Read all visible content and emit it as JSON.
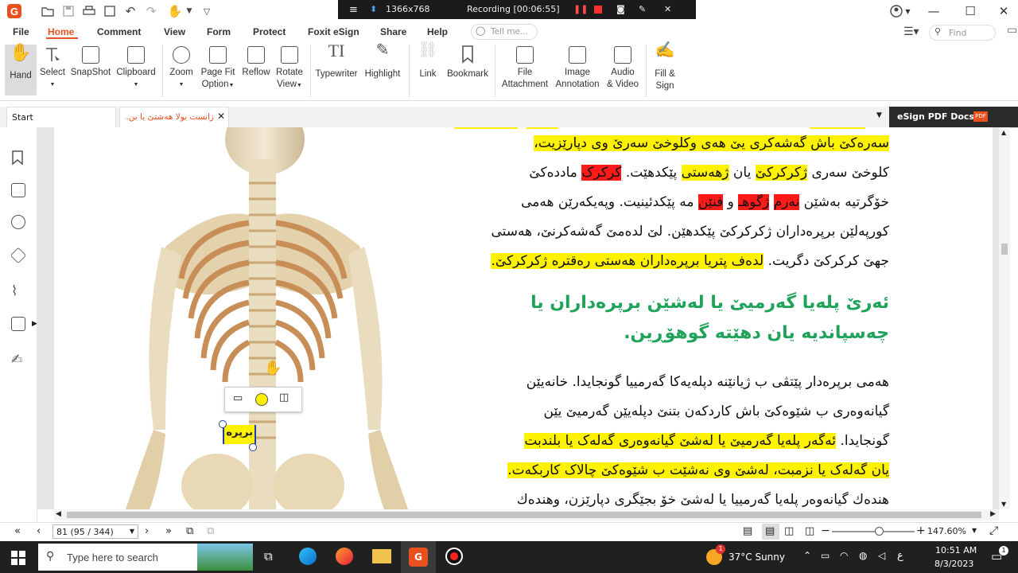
{
  "titlebar": {
    "resolution": "1366x768",
    "recording": "Recording [00:06:55]"
  },
  "menu": [
    "File",
    "Home",
    "Comment",
    "View",
    "Form",
    "Protect",
    "Foxit eSign",
    "Share",
    "Help"
  ],
  "menu_active": "Home",
  "tell_me_placeholder": "Tell me...",
  "find_placeholder": "Find",
  "ribbon": {
    "hand": "Hand",
    "select": "Select",
    "snapshot": "SnapShot",
    "clipboard": "Clipboard",
    "zoom": "Zoom",
    "page_fit_1": "Page Fit",
    "page_fit_2": "Option",
    "reflow": "Reflow",
    "rotate_1": "Rotate",
    "rotate_2": "View",
    "typewriter": "Typewriter",
    "highlight": "Highlight",
    "link": "Link",
    "bookmark": "Bookmark",
    "file_att_1": "File",
    "file_att_2": "Attachment",
    "image_ann_1": "Image",
    "image_ann_2": "Annotation",
    "audio_1": "Audio",
    "audio_2": "& Video",
    "fill_1": "Fill &",
    "fill_2": "Sign"
  },
  "tabs": {
    "start": "Start",
    "doc_tab": "زانست یولا هەشتێ یا بن...",
    "esign": "eSign PDF Docs"
  },
  "document": {
    "lines": [
      {
        "segments": [
          {
            "t": "سەرەکێ باش گەشەکری یێ هەی وکلوخێ سەرێ وی دپارێزیت،",
            "h": "y"
          }
        ]
      },
      {
        "segments": [
          {
            "t": "کلوخێ سەری ",
            "h": ""
          },
          {
            "t": "ژکرکرکێ",
            "h": "y"
          },
          {
            "t": " یان ",
            "h": ""
          },
          {
            "t": "ژهەستی",
            "h": "y"
          },
          {
            "t": " پێکدهێت. ",
            "h": ""
          },
          {
            "t": "کرکرک",
            "h": "r"
          },
          {
            "t": " ماددەکێ",
            "h": ""
          }
        ]
      },
      {
        "segments": [
          {
            "t": "خۆگرتیە بەشێن ",
            "h": ""
          },
          {
            "t": "نەرم",
            "h": "r"
          },
          {
            "t": " ",
            "h": ""
          },
          {
            "t": "ژگوهـ",
            "h": "r"
          },
          {
            "t": " و ",
            "h": ""
          },
          {
            "t": "فنێن",
            "h": "r"
          },
          {
            "t": " مە پێکدئینیت. وپەیکەرێن هەمی",
            "h": ""
          }
        ]
      },
      {
        "segments": [
          {
            "t": "کورپەلێن برپرەداران ژکرکرکێ پێکدهێن. لێ لدەمێ گەشەکرنێ، هەستی",
            "h": ""
          }
        ]
      },
      {
        "segments": [
          {
            "t": "جهێ کرکرکێ دگریت. ",
            "h": ""
          },
          {
            "t": "لدەف پتریا برپرەداران هەستی رەقترە ژکرکرکێ.",
            "h": "y"
          }
        ]
      }
    ],
    "heading_1": "ئەرێ پلەیا گەرمیێ یا لەشێن برپرەداران یا",
    "heading_2": "چەسپاندیە یان دهێتە گوهۆڕین.",
    "lines2": [
      {
        "segments": [
          {
            "t": "هەمی برپرەدار پێتڤی ب ژیانێنە دپلەیەکا گەرمییا گونجایدا. خانەیێن",
            "h": ""
          }
        ]
      },
      {
        "segments": [
          {
            "t": "گیانەوەری ب شێوەکێ باش کاردکەن بتنێ دپلەیێن گەرمیێ یێن",
            "h": ""
          }
        ]
      },
      {
        "segments": [
          {
            "t": "گونجایدا. ",
            "h": ""
          },
          {
            "t": "ئەگەر پلەیا گەرمیێ یا لەشێ گیانەوەری گەلەک یا بلندبت",
            "h": "y"
          }
        ]
      },
      {
        "segments": [
          {
            "t": "یان گەلەک یا نزمبت، لەشێ وی نەشێت ب شێوەکێ چالاک کاربکەت.",
            "h": "y"
          }
        ]
      },
      {
        "segments": [
          {
            "t": "هندەك گیانەوەر پلەیا گەرمییا یا لەشێ خۆ بجێگری دپارێزن، وهندەك",
            "h": ""
          }
        ]
      }
    ],
    "annotation_word": "برپرە"
  },
  "status": {
    "page_value": "81 (95 / 344)",
    "zoom": "147.60%"
  },
  "taskbar": {
    "search_placeholder": "Type here to search",
    "weather": "37°C  Sunny",
    "lang": "ع",
    "time": "10:51 AM",
    "date": "8/3/2023",
    "badge": "1"
  },
  "colors": {
    "accent": "#e8501e",
    "highlight_yellow": "#fff200",
    "highlight_red": "#ff1a1a",
    "heading_green": "#1fa35a"
  }
}
